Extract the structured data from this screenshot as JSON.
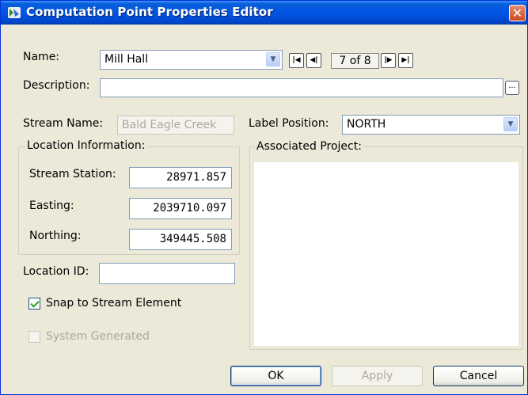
{
  "window": {
    "title": "Computation Point Properties Editor",
    "icons": {
      "app": "app-icon",
      "close": "close-icon"
    }
  },
  "name": {
    "label": "Name:",
    "value": "Mill Hall",
    "nav": {
      "first": "first-record-icon",
      "prev": "previous-record-icon",
      "counter": "7 of 8",
      "next": "next-record-icon",
      "last": "last-record-icon"
    }
  },
  "description": {
    "label": "Description:",
    "value": "",
    "browse_label": "..."
  },
  "stream": {
    "label": "Stream Name:",
    "value": "Bald Eagle Creek"
  },
  "label_position": {
    "label": "Label Position:",
    "value": "NORTH"
  },
  "location": {
    "group_title": "Location Information:",
    "stream_station": {
      "label": "Stream Station:",
      "value": "28971.857"
    },
    "easting": {
      "label": "Easting:",
      "value": "2039710.097"
    },
    "northing": {
      "label": "Northing:",
      "value": "349445.508"
    }
  },
  "associated_project": {
    "group_title": "Associated Project:"
  },
  "location_id": {
    "label": "Location ID:",
    "value": ""
  },
  "snap": {
    "label": "Snap to Stream Element",
    "checked": true
  },
  "system_generated": {
    "label": "System Generated",
    "checked": false,
    "enabled": false
  },
  "buttons": {
    "ok": "OK",
    "apply": "Apply",
    "cancel": "Cancel"
  },
  "colors": {
    "title_bar": "#0055e5",
    "dialog_bg": "#ece9d8",
    "field_border": "#7f9db9",
    "close": "#c94a1f",
    "check": "#21a121"
  }
}
